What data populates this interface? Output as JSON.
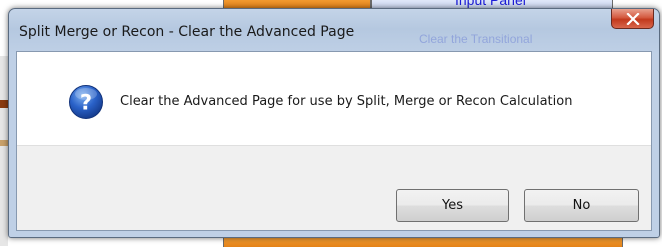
{
  "background": {
    "partial_text_top": "Input Panel",
    "partial_text_second": "Clear the Transitional"
  },
  "dialog": {
    "title": "Split Merge or Recon - Clear the Advanced Page",
    "message": "Clear the Advanced Page for use by Split, Merge or Recon Calculation",
    "icon": "question-icon",
    "buttons": {
      "yes": "Yes",
      "no": "No"
    },
    "close_icon": "close-icon"
  },
  "colors": {
    "title_bar": "#b5c8e0",
    "close_button": "#c2391d",
    "question_icon": "#1e4fb4",
    "background_orange": "#e07b12"
  }
}
